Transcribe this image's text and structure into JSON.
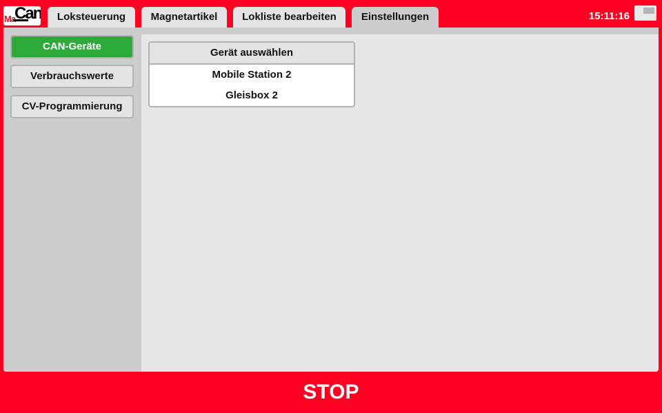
{
  "app": {
    "logo": {
      "text_ma": "Ma",
      "text_can": "Can"
    },
    "clock": "15:11:16"
  },
  "tabs": [
    {
      "label": "Loksteuerung"
    },
    {
      "label": "Magnetartikel"
    },
    {
      "label": "Lokliste bearbeiten"
    },
    {
      "label": "Einstellungen",
      "active": true
    }
  ],
  "sidebar": {
    "items": [
      {
        "label": "CAN-Geräte",
        "active": true
      },
      {
        "label": "Verbrauchswerte"
      },
      {
        "label": "CV-Programmierung"
      }
    ]
  },
  "devices": {
    "header": "Gerät auswählen",
    "items": [
      {
        "label": "Mobile Station 2"
      },
      {
        "label": "Gleisbox 2"
      }
    ]
  },
  "footer": {
    "stop_label": "STOP"
  },
  "colors": {
    "brand_red": "#ff0022",
    "active_green": "#2eaa3a",
    "panel_gray": "#cdcdcd",
    "content_gray": "#e6e6e6"
  },
  "icons": {
    "screen": "screen-icon"
  }
}
